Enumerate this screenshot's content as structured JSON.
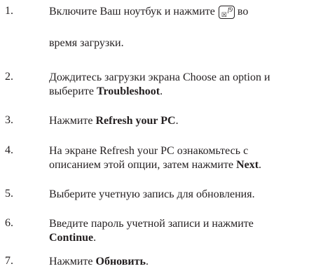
{
  "steps": [
    {
      "number": "1.",
      "pre": "Включите Ваш ноутбук и нажмите",
      "key_label": "f9",
      "key_icon": "recovery-key-icon",
      "post": "во",
      "line2": "время загрузки."
    },
    {
      "number": "2.",
      "line1": "Дождитесь загрузки экрана Choose an option и",
      "line2_pre": "выберите ",
      "bold": "Troubleshoot",
      "line2_post": "."
    },
    {
      "number": "3.",
      "pre": "Нажмите ",
      "bold": "Refresh your PC",
      "post": "."
    },
    {
      "number": "4.",
      "line1": "На экране Refresh your PC ознакомьтесь с",
      "line2_pre": "описанием этой опции, затем нажмите ",
      "bold": "Next",
      "line2_post": "."
    },
    {
      "number": "5.",
      "text": "Выберите учетную запись для обновления."
    },
    {
      "number": "6.",
      "line1": "Введите пароль учетной записи и нажмите",
      "bold": "Continue",
      "line2_post": "."
    },
    {
      "number": "7.",
      "pre": "Нажмите ",
      "bold": "Обновить",
      "post": "."
    }
  ]
}
